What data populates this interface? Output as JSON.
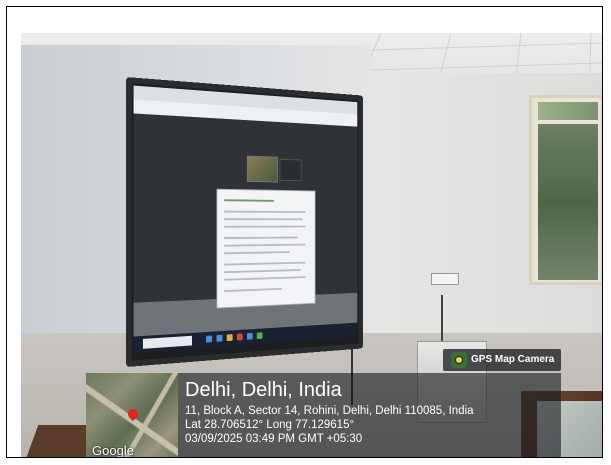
{
  "overlay": {
    "app_badge": "GPS Map Camera",
    "location_title": "Delhi, Delhi, India",
    "address": "11, Block A, Sector 14, Rohini, Delhi, Delhi 110085, India",
    "coordinates": "Lat 28.706512° Long 77.129615°",
    "timestamp": "03/09/2025 03:49 PM GMT +05:30",
    "map_brand": "Google"
  },
  "icons": {
    "app": "camera-pin-icon",
    "map_marker": "map-pin-icon"
  },
  "colors": {
    "overlay_bg": "#1c1e22",
    "pin": "#e0241b"
  }
}
